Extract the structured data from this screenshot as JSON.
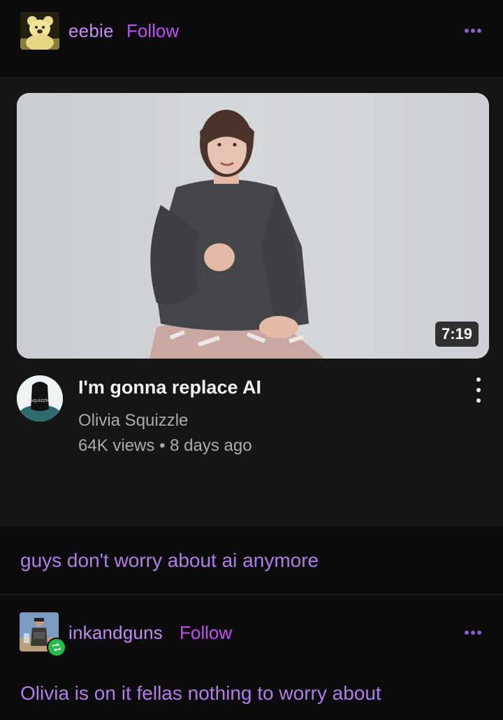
{
  "post": {
    "username": "eebie",
    "follow_label": "Follow"
  },
  "video": {
    "duration": "7:19",
    "title": "I'm gonna replace AI",
    "channel": "Olivia Squizzle",
    "views": "64K views",
    "separator": "•",
    "age": "8 days ago",
    "avatar_text": "Squizzle"
  },
  "caption": "guys don't worry about ai anymore",
  "reblog": {
    "username": "inkandguns",
    "follow_label": "Follow",
    "text": "Olivia is on it fellas nothing to worry about"
  },
  "colors": {
    "background": "#0b0b0c",
    "embed_background": "#151516",
    "accent_purple": "#c04ff2",
    "text_purple": "#b07de6",
    "reblog_green": "#25b84a"
  }
}
